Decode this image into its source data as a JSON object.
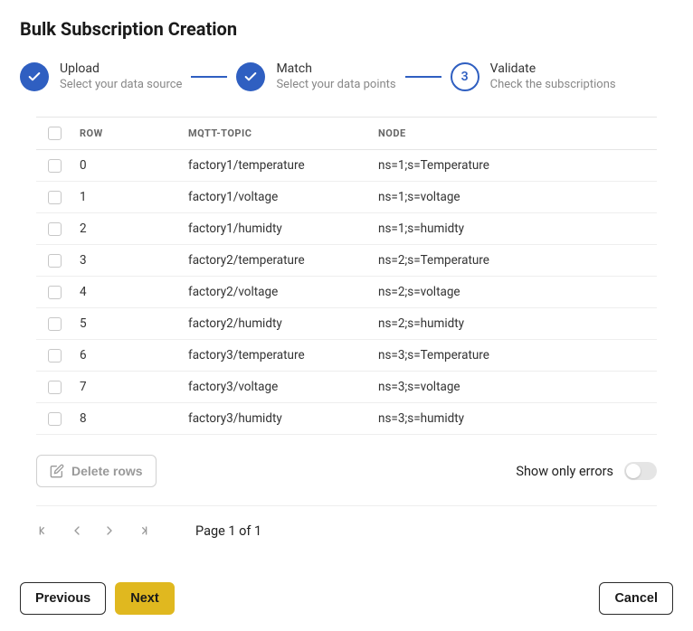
{
  "title": "Bulk Subscription Creation",
  "steps": [
    {
      "label": "Upload",
      "sub": "Select your data source",
      "state": "done",
      "badge": "✓"
    },
    {
      "label": "Match",
      "sub": "Select your data points",
      "state": "done",
      "badge": "✓"
    },
    {
      "label": "Validate",
      "sub": "Check the subscriptions",
      "state": "current",
      "badge": "3"
    }
  ],
  "table": {
    "headers": {
      "row": "Row",
      "topic": "MQTT-Topic",
      "node": "Node"
    },
    "rows": [
      {
        "row": "0",
        "topic": "factory1/temperature",
        "node": "ns=1;s=Temperature"
      },
      {
        "row": "1",
        "topic": "factory1/voltage",
        "node": "ns=1;s=voltage"
      },
      {
        "row": "2",
        "topic": "factory1/humidty",
        "node": "ns=1;s=humidty"
      },
      {
        "row": "3",
        "topic": "factory2/temperature",
        "node": "ns=2;s=Temperature"
      },
      {
        "row": "4",
        "topic": "factory2/voltage",
        "node": "ns=2;s=voltage"
      },
      {
        "row": "5",
        "topic": "factory2/humidty",
        "node": "ns=2;s=humidty"
      },
      {
        "row": "6",
        "topic": "factory3/temperature",
        "node": "ns=3;s=Temperature"
      },
      {
        "row": "7",
        "topic": "factory3/voltage",
        "node": "ns=3;s=voltage"
      },
      {
        "row": "8",
        "topic": "factory3/humidty",
        "node": "ns=3;s=humidty"
      }
    ]
  },
  "actions": {
    "delete_rows": "Delete rows",
    "show_errors": "Show only errors",
    "show_errors_on": false
  },
  "pager": {
    "text": "Page 1 of 1"
  },
  "footer": {
    "previous": "Previous",
    "next": "Next",
    "cancel": "Cancel"
  }
}
